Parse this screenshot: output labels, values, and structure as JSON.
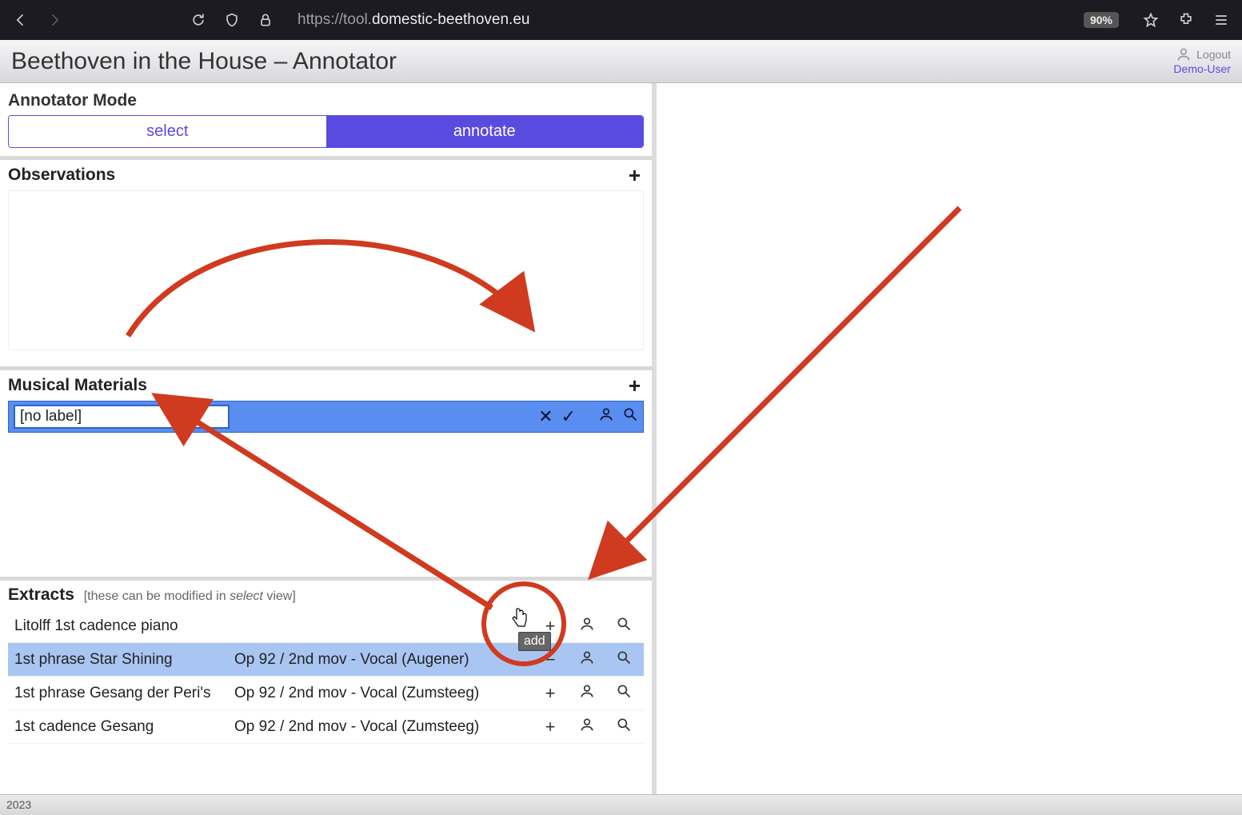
{
  "browser": {
    "url_prefix": "https://tool.",
    "url_domain": "domestic-beethoven.eu",
    "zoom": "90%"
  },
  "header": {
    "title": "Beethoven in the House – Annotator",
    "logout": "Logout",
    "user": "Demo-User"
  },
  "mode": {
    "label": "Annotator Mode",
    "select": "select",
    "annotate": "annotate"
  },
  "observations": {
    "title": "Observations"
  },
  "materials": {
    "title": "Musical Materials",
    "input_value": "[no label]"
  },
  "extracts": {
    "title": "Extracts",
    "hint_prefix": "[these can be modified in ",
    "hint_em": "select",
    "hint_suffix": " view]",
    "rows": [
      {
        "name": "Litolff 1st cadence piano",
        "detail": ""
      },
      {
        "name": "1st phrase Star Shining",
        "detail": "Op 92 / 2nd mov - Vocal (Augener)"
      },
      {
        "name": "1st phrase Gesang der Peri's",
        "detail": "Op 92 / 2nd mov - Vocal (Zumsteeg)"
      },
      {
        "name": "1st cadence Gesang",
        "detail": "Op 92 / 2nd mov - Vocal (Zumsteeg)"
      }
    ]
  },
  "tooltip": "add",
  "footer": "2023",
  "colors": {
    "accent": "#5a4be0",
    "selection": "#5a8df0",
    "annotation": "#d03a1f"
  }
}
